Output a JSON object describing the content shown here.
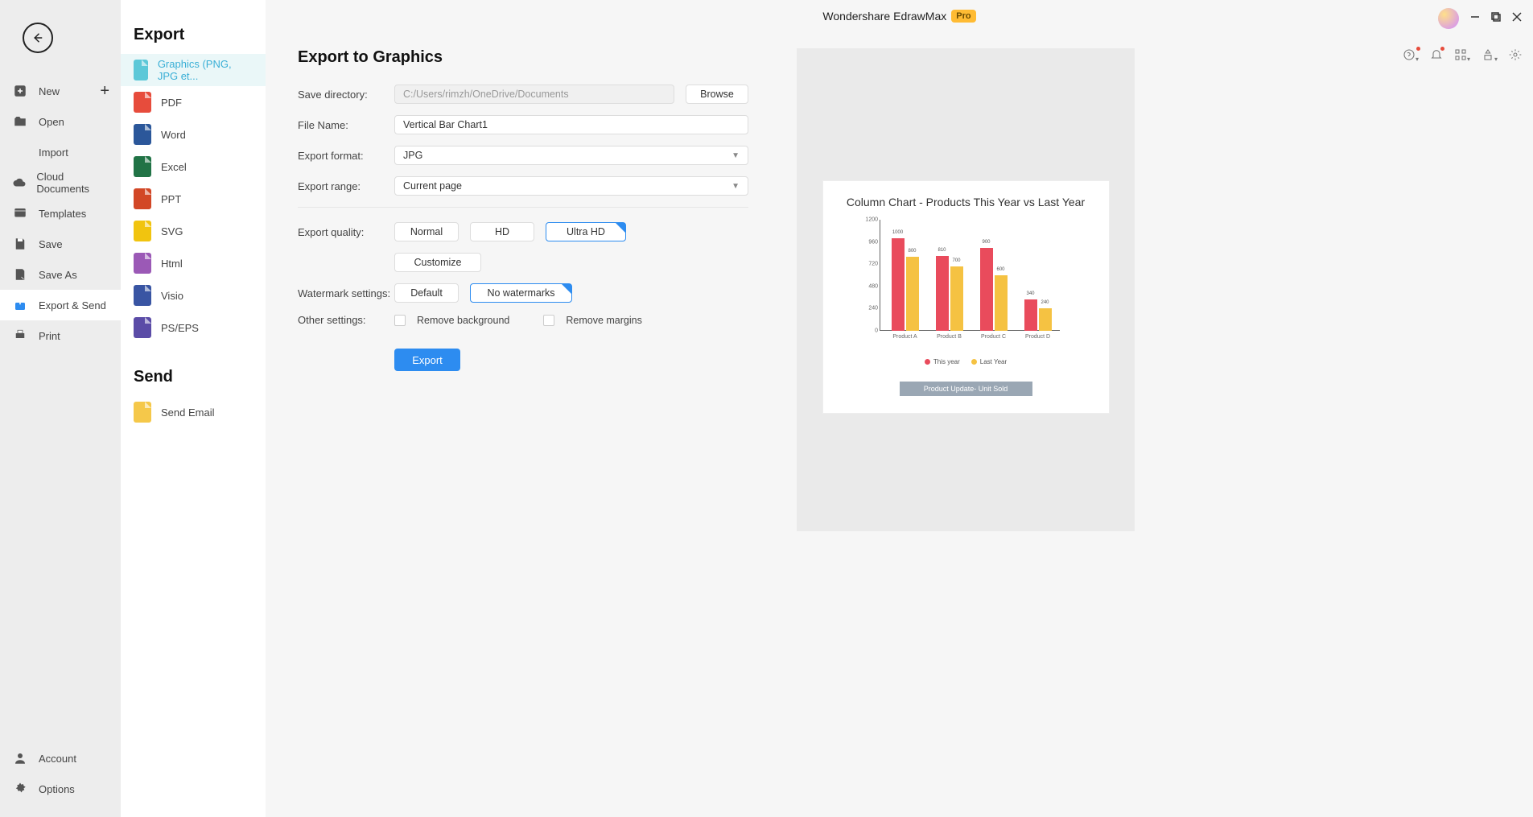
{
  "app": {
    "title": "Wondershare EdrawMax",
    "pro": "Pro"
  },
  "nav": {
    "new": "New",
    "open": "Open",
    "import": "Import",
    "cloud": "Cloud Documents",
    "templates": "Templates",
    "save": "Save",
    "saveas": "Save As",
    "exportsend": "Export & Send",
    "print": "Print",
    "account": "Account",
    "options": "Options"
  },
  "types": {
    "heading_export": "Export",
    "heading_send": "Send",
    "graphics": "Graphics (PNG, JPG et...",
    "pdf": "PDF",
    "word": "Word",
    "excel": "Excel",
    "ppt": "PPT",
    "svg": "SVG",
    "html": "Html",
    "visio": "Visio",
    "pseps": "PS/EPS",
    "email": "Send Email"
  },
  "form": {
    "title": "Export to Graphics",
    "save_dir_lbl": "Save directory:",
    "save_dir_val": "C:/Users/rimzh/OneDrive/Documents",
    "browse": "Browse",
    "file_name_lbl": "File Name:",
    "file_name_val": "Vertical Bar Chart1",
    "format_lbl": "Export format:",
    "format_val": "JPG",
    "range_lbl": "Export range:",
    "range_val": "Current page",
    "quality_lbl": "Export quality:",
    "q_normal": "Normal",
    "q_hd": "HD",
    "q_uhd": "Ultra HD",
    "q_custom": "Customize",
    "wm_lbl": "Watermark settings:",
    "wm_default": "Default",
    "wm_none": "No watermarks",
    "other_lbl": "Other settings:",
    "remove_bg": "Remove background",
    "remove_marg": "Remove margins",
    "export_btn": "Export"
  },
  "chart_data": {
    "type": "bar",
    "title": "Column Chart - Products This Year vs Last Year",
    "footer": "Product Update- Unit Sold",
    "categories": [
      "Product A",
      "Product B",
      "Product C",
      "Product D"
    ],
    "ylim": [
      0,
      1200
    ],
    "yticks": [
      0,
      240,
      480,
      720,
      960,
      1200
    ],
    "series": [
      {
        "name": "This year",
        "values": [
          1000,
          810,
          900,
          340
        ]
      },
      {
        "name": "Last Year",
        "values": [
          800,
          700,
          600,
          240
        ]
      }
    ]
  }
}
